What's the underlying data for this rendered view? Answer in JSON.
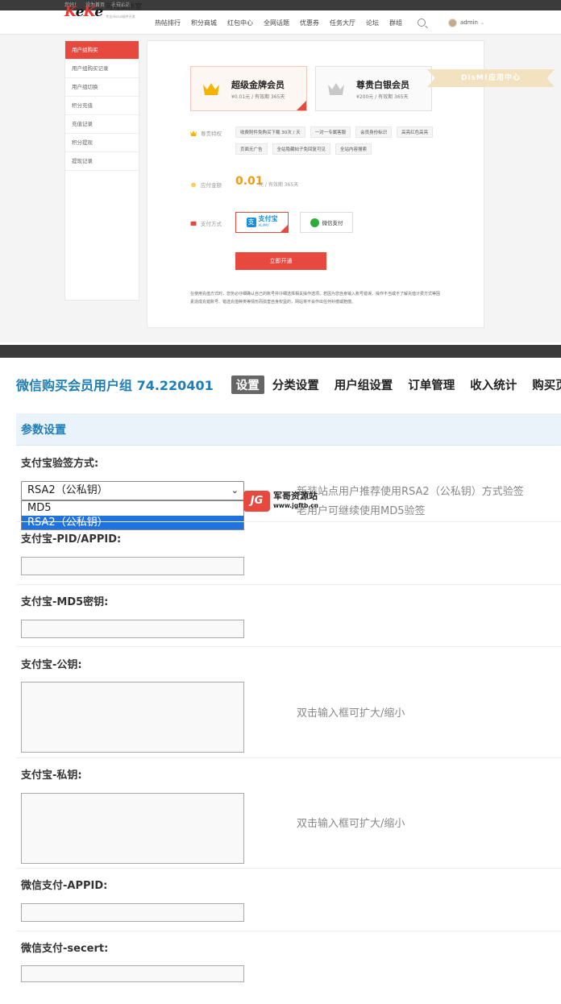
{
  "top": {
    "topbar_links": [
      "您好！",
      "设为首页",
      "收藏本站"
    ],
    "logo_text": "KeKe",
    "logo_name": "可可工作室",
    "logo_tagline": "专注discuz插件开发",
    "nav": [
      "热帖排行",
      "积分商城",
      "红包中心",
      "全网话题",
      "优惠券",
      "任务大厅",
      "论坛",
      "群组"
    ],
    "username": "admin",
    "side_menu": [
      "用户组购买",
      "用户组购买记录",
      "用户组切换",
      "积分充值",
      "充值记录",
      "积分提现",
      "提现记录"
    ],
    "cards": [
      {
        "title": "超级金牌会员",
        "subtitle": "¥0.01元 / 有效期 365天"
      },
      {
        "title": "尊贵白银会员",
        "subtitle": "¥200元 / 有效期 365天"
      }
    ],
    "ribbon": "DisM!应用中心",
    "privilege_label": "尊贵特权",
    "privileges_row1": [
      "收费附件免购买下载 30次 / 天",
      "一对一专属客服",
      "会员身份标识",
      "高亮红色高亮"
    ],
    "privileges_row2": [
      "页面无广告",
      "全站隐藏帖子免回复可见",
      "全站内容搜索"
    ],
    "amount_label": "应付金额",
    "amount": "0.01",
    "amount_unit": "元 / 有效期 365天",
    "pay_label": "支付方式",
    "alipay_name": "支付宝",
    "alipay_en": "ALIPAY",
    "wechat_name": "微信支付",
    "open_button": "立即开通",
    "note": "在使用充值方式时，您务必仔细确认自己的账号并仔细选择相关操作选项。若因为您自身输入账号错误、操作不当或不了解充值计费方式等因素造成充错账号、错选充值种类等情形而损害自身权益的，网站将不会作出任何补偿或赔偿。"
  },
  "bottom": {
    "app_title": "微信购买会员用户组 74.220401",
    "tabs": [
      "设置",
      "分类设置",
      "用户组设置",
      "订单管理",
      "收入统计",
      "购买页"
    ],
    "section_title": "参数设置",
    "sign_label": "支付宝验签方式:",
    "sign_value": "RSA2（公私钥）",
    "sign_options": [
      "MD5",
      "RSA2（公私钥）"
    ],
    "sign_hint1": "新装站点用户推荐使用RSA2（公私钥）方式验签",
    "sign_hint2": "老用户可继续使用MD5验签",
    "pid_label": "支付宝-PID/APPID:",
    "md5_label": "支付宝-MD5密钥:",
    "pubkey_label": "支付宝-公钥:",
    "pubkey_hint": "双击输入框可扩大/缩小",
    "privkey_label": "支付宝-私钥:",
    "privkey_hint": "双击输入框可扩大/缩小",
    "wx_appid_label": "微信支付-APPID:",
    "wx_secret_label": "微信支付-secert:",
    "watermark_badge": "JG",
    "watermark_name": "军哥资源站",
    "watermark_url": "www.jgftb.cn"
  }
}
